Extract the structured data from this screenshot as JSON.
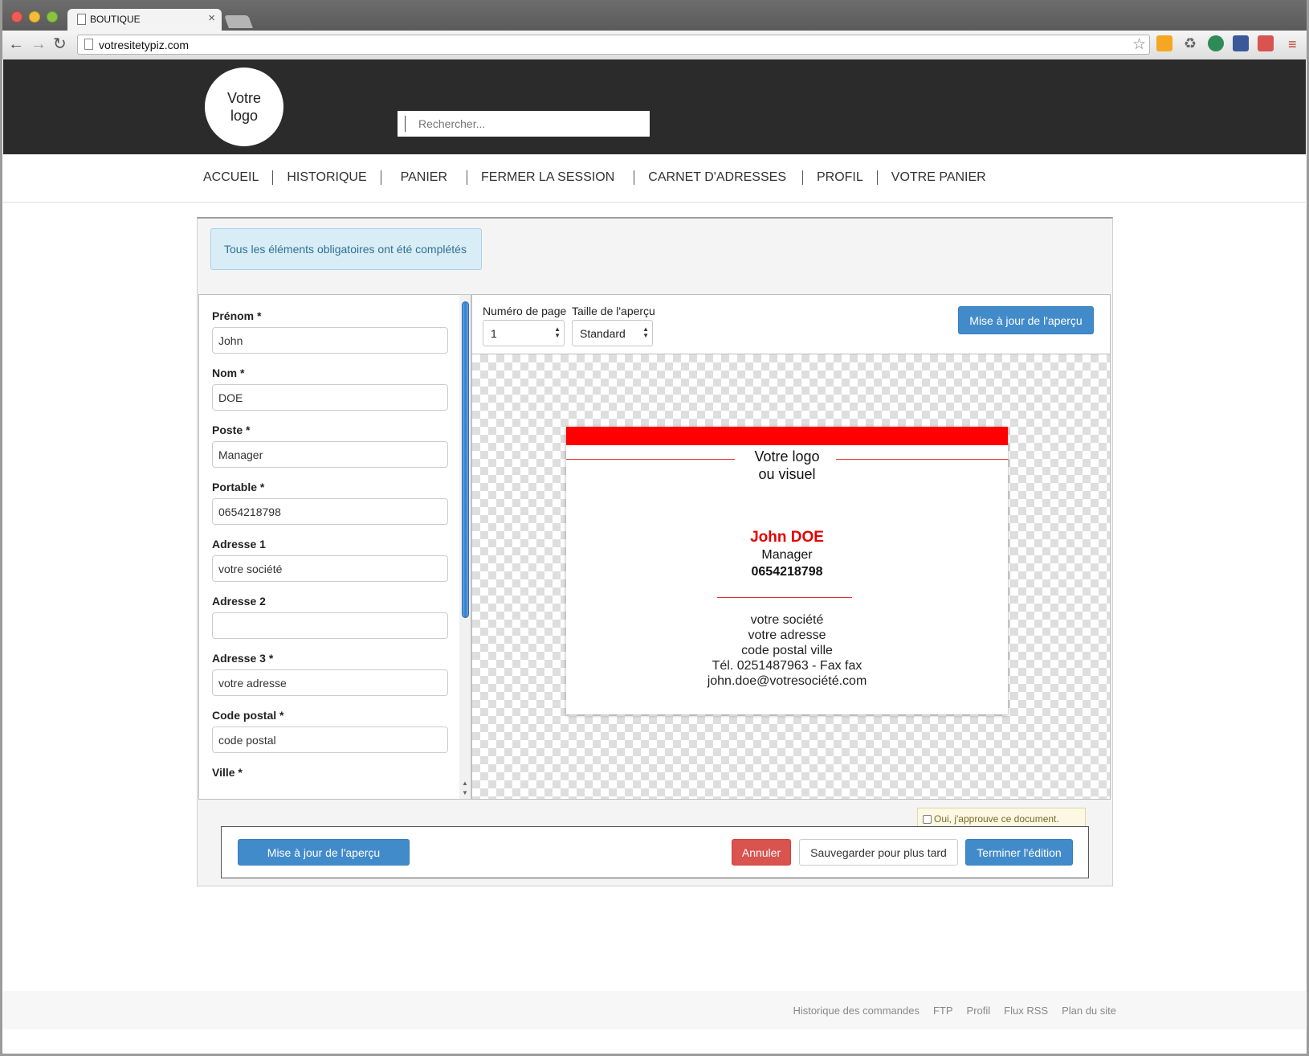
{
  "browser": {
    "tab_title": "BOUTIQUE",
    "url": "votresitetypiz.com",
    "icons": [
      "back-icon",
      "forward-icon",
      "reload-icon",
      "page-icon",
      "star-icon",
      "menu-icon"
    ]
  },
  "header": {
    "logo_line1": "Votre",
    "logo_line2": "logo",
    "search_placeholder": "Rechercher..."
  },
  "nav": {
    "items": [
      "ACCUEIL",
      "HISTORIQUE",
      "PANIER",
      "FERMER LA SESSION",
      "CARNET D'ADRESSES",
      "PROFIL",
      "VOTRE PANIER"
    ]
  },
  "alert": {
    "message": "Tous les éléments obligatoires ont été complétés"
  },
  "form": {
    "fields": [
      {
        "label": "Prénom *",
        "value": "John"
      },
      {
        "label": "Nom *",
        "value": "DOE"
      },
      {
        "label": "Poste *",
        "value": "Manager"
      },
      {
        "label": "Portable *",
        "value": "0654218798"
      },
      {
        "label": "Adresse 1",
        "value": "votre société"
      },
      {
        "label": "Adresse 2",
        "value": ""
      },
      {
        "label": "Adresse 3 *",
        "value": "votre adresse"
      },
      {
        "label": "Code postal *",
        "value": "code postal"
      },
      {
        "label": "Ville *",
        "value": ""
      }
    ]
  },
  "preview": {
    "page_label": "Numéro de page",
    "page_value": "1",
    "size_label": "Taille de l'aperçu",
    "size_value": "Standard",
    "update_button": "Mise à jour de l'aperçu"
  },
  "card": {
    "logo_line1": "Votre logo",
    "logo_line2": "ou visuel",
    "name": "John DOE",
    "job": "Manager",
    "phone": "0654218798",
    "address_lines": [
      "votre société",
      "votre adresse",
      "code postal ville",
      "Tél. 0251487963 - Fax fax",
      "john.doe@votresociété.com"
    ],
    "accent_color": "#ff0000"
  },
  "actions": {
    "approve_label": "Oui, j'approuve ce document.",
    "update_preview": "Mise à jour de l'aperçu",
    "cancel": "Annuler",
    "save_later": "Sauvegarder pour plus tard",
    "finish": "Terminer l'édition"
  },
  "footer": {
    "links": [
      "Historique des commandes",
      "FTP",
      "Profil",
      "Flux RSS",
      "Plan du site"
    ]
  }
}
